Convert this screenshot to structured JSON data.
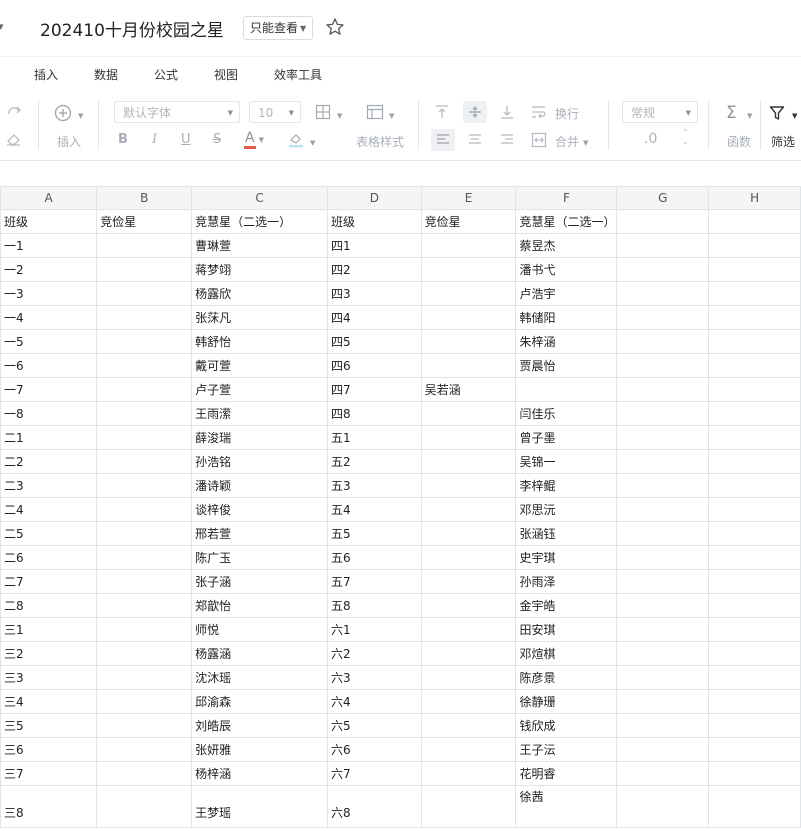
{
  "title": {
    "doc_name": "202410十月份校园之星",
    "permission_badge": "只能查看"
  },
  "menu": [
    "插入",
    "数据",
    "公式",
    "视图",
    "效率工具"
  ],
  "toolbar": {
    "insert_label": "插入",
    "font_name": "默认字体",
    "font_size": "10",
    "table_style_label": "表格样式",
    "wrap_label": "换行",
    "merge_label": "合并",
    "number_format": "常规",
    "decimal_text": ".0",
    "function_label": "函数",
    "filter_label": "筛选",
    "bold": "B",
    "italic": "I",
    "underline": "U",
    "strike": "S",
    "font_color": "A"
  },
  "sheet": {
    "columns": [
      "A",
      "B",
      "C",
      "D",
      "E",
      "F",
      "G",
      "H"
    ],
    "rows": [
      [
        "班级",
        "竞俭星",
        "竞慧星（二选一）",
        "班级",
        "竞俭星",
        "竞慧星（二选一）",
        "",
        ""
      ],
      [
        "一1",
        "",
        "曹琳萱",
        "四1",
        "",
        "蔡昱杰",
        "",
        ""
      ],
      [
        "一2",
        "",
        "蒋梦翊",
        "四2",
        "",
        "潘书弋",
        "",
        ""
      ],
      [
        "一3",
        "",
        "杨露欣",
        "四3",
        "",
        "卢浩宇",
        "",
        ""
      ],
      [
        "一4",
        "",
        "张莯凡",
        "四4",
        "",
        "韩储阳",
        "",
        ""
      ],
      [
        "一5",
        "",
        "韩舒怡",
        "四5",
        "",
        "朱梓涵",
        "",
        ""
      ],
      [
        "一6",
        "",
        "戴可萱",
        "四6",
        "",
        "贾晨怡",
        "",
        ""
      ],
      [
        "一7",
        "",
        "卢子萱",
        "四7",
        "吴若涵",
        "",
        "",
        ""
      ],
      [
        "一8",
        "",
        "王雨潆",
        "四8",
        "",
        "闫佳乐",
        "",
        ""
      ],
      [
        "二1",
        "",
        "薛浚瑞",
        "五1",
        "",
        "曾子墨",
        "",
        ""
      ],
      [
        "二2",
        "",
        "孙浩铭",
        "五2",
        "",
        "吴锦一",
        "",
        ""
      ],
      [
        "二3",
        "",
        "潘诗颖",
        "五3",
        "",
        "李梓鲲",
        "",
        ""
      ],
      [
        "二4",
        "",
        "谈梓俊",
        "五4",
        "",
        "邓思沅",
        "",
        ""
      ],
      [
        "二5",
        "",
        "邢若萱",
        "五5",
        "",
        "张涵钰",
        "",
        ""
      ],
      [
        "二6",
        "",
        "陈广玉",
        "五6",
        "",
        "史宇琪",
        "",
        ""
      ],
      [
        "二7",
        "",
        "张子涵",
        "五7",
        "",
        "孙雨泽",
        "",
        ""
      ],
      [
        "二8",
        "",
        "郑歆怡",
        "五8",
        "",
        "金宇皓",
        "",
        ""
      ],
      [
        "三1",
        "",
        "师悦",
        "六1",
        "",
        "田安琪",
        "",
        ""
      ],
      [
        "三2",
        "",
        "杨露涵",
        "六2",
        "",
        "邓煊棋",
        "",
        ""
      ],
      [
        "三3",
        "",
        "沈沐瑶",
        "六3",
        "",
        "陈彦景",
        "",
        ""
      ],
      [
        "三4",
        "",
        "邱渝森",
        "六4",
        "",
        "徐静珊",
        "",
        ""
      ],
      [
        "三5",
        "",
        "刘皓辰",
        "六5",
        "",
        "钱欣成",
        "",
        ""
      ],
      [
        "三6",
        "",
        "张妍雅",
        "六6",
        "",
        "王子沄",
        "",
        ""
      ],
      [
        "三7",
        "",
        "杨梓涵",
        "六7",
        "",
        "花明睿",
        "",
        ""
      ],
      [
        "三8",
        "",
        "王梦瑶",
        "六8",
        "",
        "徐茜",
        "",
        ""
      ]
    ]
  }
}
